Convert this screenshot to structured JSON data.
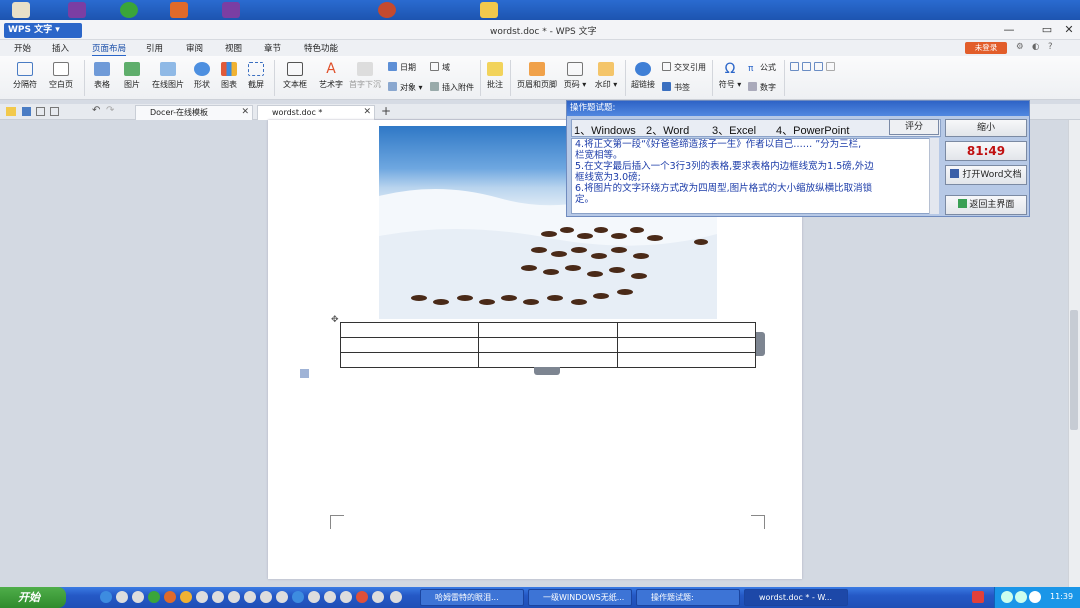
{
  "window": {
    "app_name": "WPS 文字",
    "doc_title": "wordst.doc * - WPS 文字"
  },
  "menu": {
    "items": [
      "开始",
      "插入",
      "页面布局",
      "引用",
      "审阅",
      "视图",
      "章节",
      "特色功能"
    ],
    "active": "页面布局",
    "login": "未登录"
  },
  "ribbon": {
    "section_break": "分隔符",
    "blank_page": "空白页",
    "table": "表格",
    "picture": "图片",
    "online_picture": "在线图片",
    "shape": "形状",
    "chart": "图表",
    "screenshot": "截屏",
    "textbox": "文本框",
    "wordart": "艺术字",
    "dropcap": "首字下沉",
    "date": "日期",
    "object": "对象",
    "field": "域",
    "attachment": "插入附件",
    "comment": "批注",
    "header_footer": "页眉和页脚",
    "page_number": "页码",
    "watermark": "水印",
    "hyperlink": "超链接",
    "cross_ref": "交叉引用",
    "bookmark": "书签",
    "symbol": "符号",
    "formula": "公式",
    "number": "数字"
  },
  "tabs": {
    "docer": "Docer-在线模板",
    "doc": "wordst.doc *",
    "add": "+"
  },
  "dialog": {
    "title": "操作题试题:",
    "tabs": [
      "1、Windows",
      "2、Word",
      "3、Excel",
      "4、PowerPoint"
    ],
    "score": "评分",
    "minimize": "缩小",
    "timer": "81:49",
    "open_word": "打开Word文档",
    "back_main": "返回主界面",
    "lines": [
      "4.将正文第一段“《好爸爸缔造孩子一生》作者以自己…… ”分为三栏,",
      "栏宽相等。",
      "5.在文字最后插入一个3行3列的表格,要求表格内边框线宽为1.5磅,外边",
      "框线宽为3.0磅;",
      "6.将图片的文字环绕方式改为四周型,图片格式的大小缩放纵横比取消锁",
      "定。"
    ]
  },
  "taskbar": {
    "start": "开始",
    "tasks": [
      "哈姆雷特的眼泪...",
      "一级WINDOWS无纸...",
      "操作题试题:",
      "wordst.doc * - W..."
    ],
    "clock": "11:39"
  },
  "colors": {
    "accent": "#2b66c9",
    "timer": "#c01010",
    "task_text": "#1b3ba8"
  }
}
